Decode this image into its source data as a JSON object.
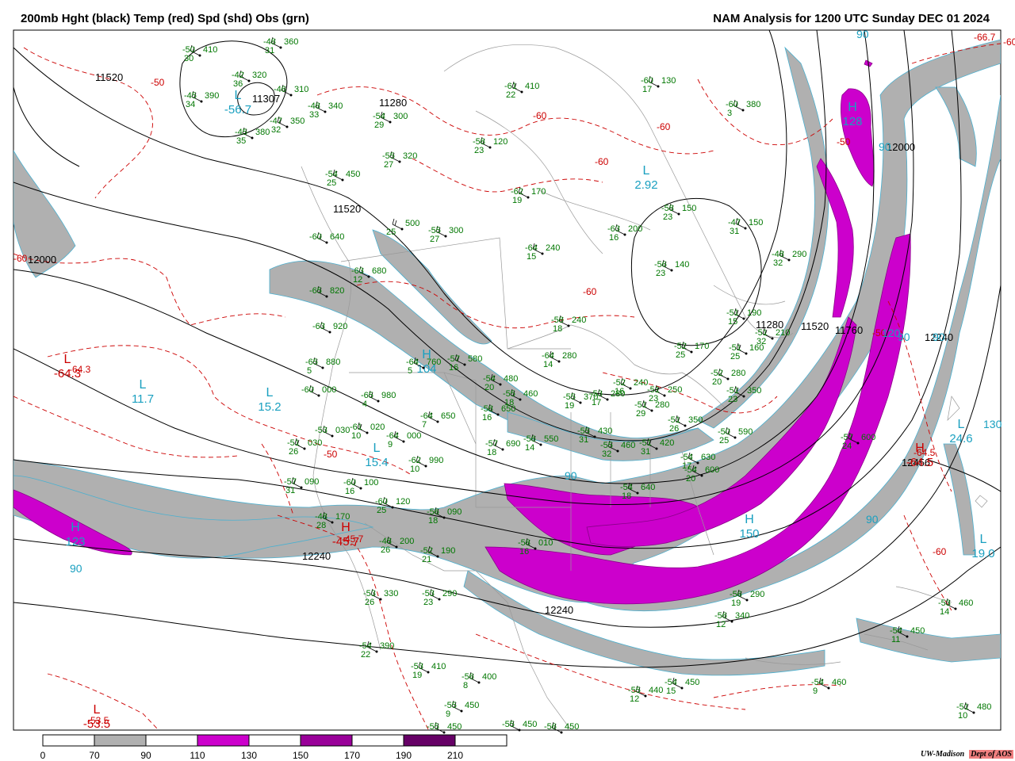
{
  "header": {
    "left_title": "200mb Hght (black) Temp (red) Spd (shd) Obs (grn)",
    "right_title": "NAM Analysis for 1200 UTC Sunday  DEC 01 2024"
  },
  "colors": {
    "height_contour": "#000000",
    "temperature_contour": "#cc0000",
    "observation_text": "#007700",
    "speed_label": "#1aa0c0",
    "speed_70_90": "#b0b0b0",
    "speed_110_130": "#cc00cc",
    "speed_150_170": "#990099",
    "speed_190_210": "#660066",
    "borders": "#999999"
  },
  "legend": {
    "ticks": [
      "0",
      "70",
      "90",
      "110",
      "130",
      "150",
      "170",
      "190",
      "210"
    ]
  },
  "height_labels": [
    "11520",
    "11307",
    "11280",
    "11520",
    "12000",
    "12000",
    "12240",
    "12240",
    "11280",
    "11520",
    "11760",
    "12240",
    "12456"
  ],
  "temperature_labels": [
    "-50",
    "-50",
    "-60",
    "-60",
    "-60",
    "-60",
    "-60",
    "-50",
    "-50",
    "-60",
    "-60",
    "-66.7",
    "-64.5",
    "-64.3",
    "-45.7",
    "-53.5"
  ],
  "pressure_centers": [
    {
      "letter": "L",
      "value": "-56.7"
    },
    {
      "letter": "H",
      "value": "128"
    },
    {
      "letter": "L",
      "value": "2.92"
    },
    {
      "letter": "L",
      "value": "11.7"
    },
    {
      "letter": "L",
      "value": "15.2"
    },
    {
      "letter": "H",
      "value": "104"
    },
    {
      "letter": "L",
      "value": "15.4"
    },
    {
      "letter": "H",
      "value": "123"
    },
    {
      "letter": "H",
      "value": "150"
    },
    {
      "letter": "L",
      "value": "19.0"
    },
    {
      "letter": "L",
      "value": "24.6"
    },
    {
      "letter": "H",
      "value": "-64.5"
    },
    {
      "letter": "L",
      "value": "-64.3"
    },
    {
      "letter": "H",
      "value": "-45.7"
    },
    {
      "letter": "L",
      "value": "-53.5"
    }
  ],
  "speed_labels": [
    "90",
    "90",
    "90",
    "90",
    "90",
    "90",
    "120",
    "130",
    "90"
  ],
  "observations": [
    [
      "-50",
      "410",
      "30"
    ],
    [
      "-48",
      "360",
      "31"
    ],
    [
      "-42",
      "320",
      "36"
    ],
    [
      "-46",
      "310",
      ""
    ],
    [
      "-45",
      "390",
      "34"
    ],
    [
      "-48",
      "340",
      "33"
    ],
    [
      "-47",
      "350",
      "32"
    ],
    [
      "-45",
      "380",
      "35"
    ],
    [
      "-54",
      "300",
      "29"
    ],
    [
      "-55",
      "320",
      "27"
    ],
    [
      "-54",
      "450",
      "25"
    ],
    [
      "-55",
      "300",
      "27"
    ],
    [
      "",
      "500",
      "25"
    ],
    [
      "-60",
      "640",
      ""
    ],
    [
      "-63",
      "680",
      "12"
    ],
    [
      "-65",
      "820",
      ""
    ],
    [
      "-63",
      "920",
      ""
    ],
    [
      "-65",
      "880",
      "5"
    ],
    [
      "-60",
      "000",
      ""
    ],
    [
      "-65",
      "980",
      "4"
    ],
    [
      "-64",
      "760",
      "5"
    ],
    [
      "-57",
      "580",
      "16"
    ],
    [
      "-64",
      "650",
      "7"
    ],
    [
      "-61",
      "020",
      "10"
    ],
    [
      "-53",
      "030",
      ""
    ],
    [
      "-51",
      "030",
      "26"
    ],
    [
      "-64",
      "000",
      "9"
    ],
    [
      "-62",
      "990",
      "10"
    ],
    [
      "-57",
      "090",
      "31"
    ],
    [
      "-60",
      "100",
      "16"
    ],
    [
      "-60",
      "120",
      "25"
    ],
    [
      "-56",
      "090",
      "18"
    ],
    [
      "-48",
      "170",
      "28"
    ],
    [
      "-48",
      "200",
      "26"
    ],
    [
      "-52",
      "190",
      "21"
    ],
    [
      "-53",
      "330",
      "26"
    ],
    [
      "-53",
      "290",
      "23"
    ],
    [
      "-54",
      "390",
      "22"
    ],
    [
      "-53",
      "410",
      "19"
    ],
    [
      "-56",
      "400",
      "8"
    ],
    [
      "-55",
      "450",
      "9"
    ],
    [
      "-55",
      "450",
      ""
    ],
    [
      "-55",
      "450",
      ""
    ],
    [
      "-56",
      "450",
      ""
    ],
    [
      "-55",
      "440",
      "12"
    ],
    [
      "-54",
      "450",
      "15"
    ],
    [
      "-60",
      "130",
      "17"
    ],
    [
      "-60",
      "380",
      "3"
    ],
    [
      "-61",
      "410",
      "22"
    ],
    [
      "-58",
      "120",
      "23"
    ],
    [
      "-62",
      "170",
      "19"
    ],
    [
      "-63",
      "200",
      "16"
    ],
    [
      "-64",
      "240",
      "15"
    ],
    [
      "-58",
      "150",
      "23"
    ],
    [
      "-56",
      "140",
      "23"
    ],
    [
      "-47",
      "150",
      "31"
    ],
    [
      "-48",
      "290",
      "32"
    ],
    [
      "-51",
      "190",
      "15"
    ],
    [
      "-51",
      "210",
      "32"
    ],
    [
      "-52",
      "170",
      "25"
    ],
    [
      "-51",
      "160",
      "25"
    ],
    [
      "-52",
      "280",
      "20"
    ],
    [
      "-51",
      "350",
      "23"
    ],
    [
      "-58",
      "240",
      "18"
    ],
    [
      "-64",
      "280",
      "14"
    ],
    [
      "-55",
      "370",
      "19"
    ],
    [
      "-53",
      "280",
      "17"
    ],
    [
      "-52",
      "240",
      "16"
    ],
    [
      "-51",
      "250",
      "23"
    ],
    [
      "-51",
      "280",
      "29"
    ],
    [
      "-51",
      "350",
      "26"
    ],
    [
      "-54",
      "480",
      "20"
    ],
    [
      "-55",
      "460",
      "18"
    ],
    [
      "-58",
      "650",
      "16"
    ],
    [
      "-57",
      "690",
      "18"
    ],
    [
      "-56",
      "550",
      "14"
    ],
    [
      "-55",
      "430",
      "31"
    ],
    [
      "-55",
      "460",
      "32"
    ],
    [
      "-51",
      "420",
      "31"
    ],
    [
      "-54",
      "630",
      "17"
    ],
    [
      "-54",
      "600",
      "20"
    ],
    [
      "-54",
      "640",
      "18"
    ],
    [
      "-50",
      "590",
      "25"
    ],
    [
      "-57",
      "600",
      "24"
    ],
    [
      "-58",
      "010",
      "16"
    ],
    [
      "-56",
      "290",
      "19"
    ],
    [
      "-56",
      "340",
      "12"
    ],
    [
      "-53",
      "460",
      "14"
    ],
    [
      "-54",
      "450",
      "11"
    ],
    [
      "-54",
      "460",
      "9"
    ],
    [
      "-51",
      "480",
      "10"
    ]
  ],
  "credit": {
    "institution": "UW-Madison",
    "department": "Dept of AOS"
  }
}
